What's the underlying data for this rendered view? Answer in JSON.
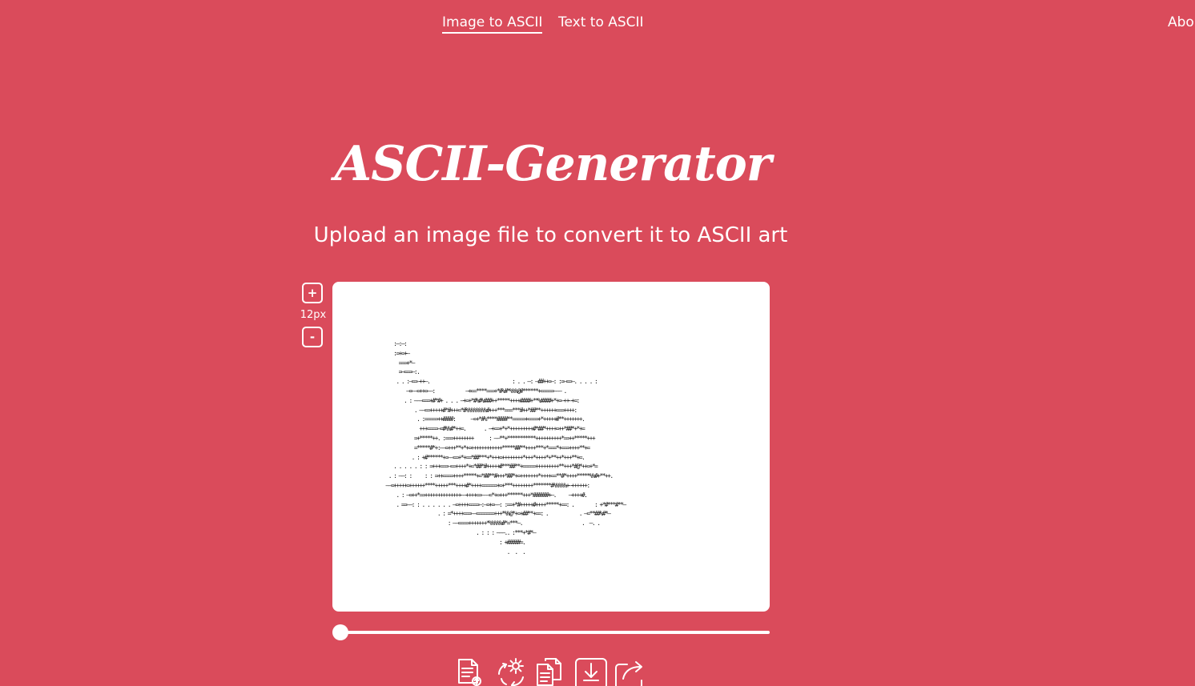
{
  "nav": {
    "image_to_ascii": "Image to ASCII",
    "text_to_ascii": "Text to ASCII",
    "about": "About"
  },
  "header": {
    "title": "ASCII-Generator",
    "subtitle": "Upload an image file to convert it to ASCII art"
  },
  "zoom": {
    "increase": "+",
    "font_size": "12px",
    "decrease": "-"
  },
  "output": {
    "ascii_art": "          :—:—:\n          :=+=+—\n            ===+*—\n            =—===—:.\n           . . :—==—++—.                                : . . —: —##++=—: :=—==—. . . . :\n               —=——=++=——:            —+==****===+*#%#*%%%@#******+=====——— .\n              . : ———===+#*#+ . . . —+=+*#%#%###++*****++++####+**%####+*+=—++—+=:\n                  . ——==+++++#*#+++=*#%%%%%%%%#+++***===***#++*##**++++++===++++:\n                   . :=====++####:      —=+*#%****####**=====+====+*+++++#**+++++++.\n                    +++====—=#%%#*++=.       . —+==+*+*+++++++++#*##*++++=++*##*+*+=\n                  =+*****++. :===++++++++      : ——**+***********++++++++++*==++*****+++\n                  =*****#*+:——=+++**+*+=++++++++++++*****##**++++***+*===*+===++++**+=\n                 . : +#******+=——==+*+==*##***+*+++=++++++++*+++*++++*+**++*+++**+=.\n          . . . . . : : =+++===—==++++*+=*##*#+++++#***##**+=====+++++++++**+++*#@*++=+*=\n        . : ——: :     : : =++====++++*****+=*##**#+++*##*+=+++++++*++++==**#*++++*****%%#+**++.\n       ——=+++++=++++++****+++++***++++#*++++======+=+***++++++++*******#%%%%%+—++++++:\n           . : —=++*==++++++++++++++——++++==———=*+=+++******+++*######+—.     —++++#.\n           . ==——: : . . . . . . —=++++====—:—=+=——: :==+*#+++++#++++*****+==: .        : +*#***#**—\n                           . : =*++++===——=======+++*%%@*+=+##**+==: .            . —=**##%#*—\n                               : ——====+++++++*%%%%%#*=***—.                       .  —. .\n                                          . : : : ———.. :***+*#*—\n                                                   : +#####=.\n                                                      .  .  ."
  },
  "actions": [
    {
      "label": "upload-icon"
    },
    {
      "label": "settings-icon"
    },
    {
      "label": "copy-icon"
    },
    {
      "label": "download-icon"
    },
    {
      "label": "share-icon"
    }
  ],
  "colors": {
    "background": "#da4b5b",
    "panel": "#ffffff",
    "text": "#ffffff"
  }
}
